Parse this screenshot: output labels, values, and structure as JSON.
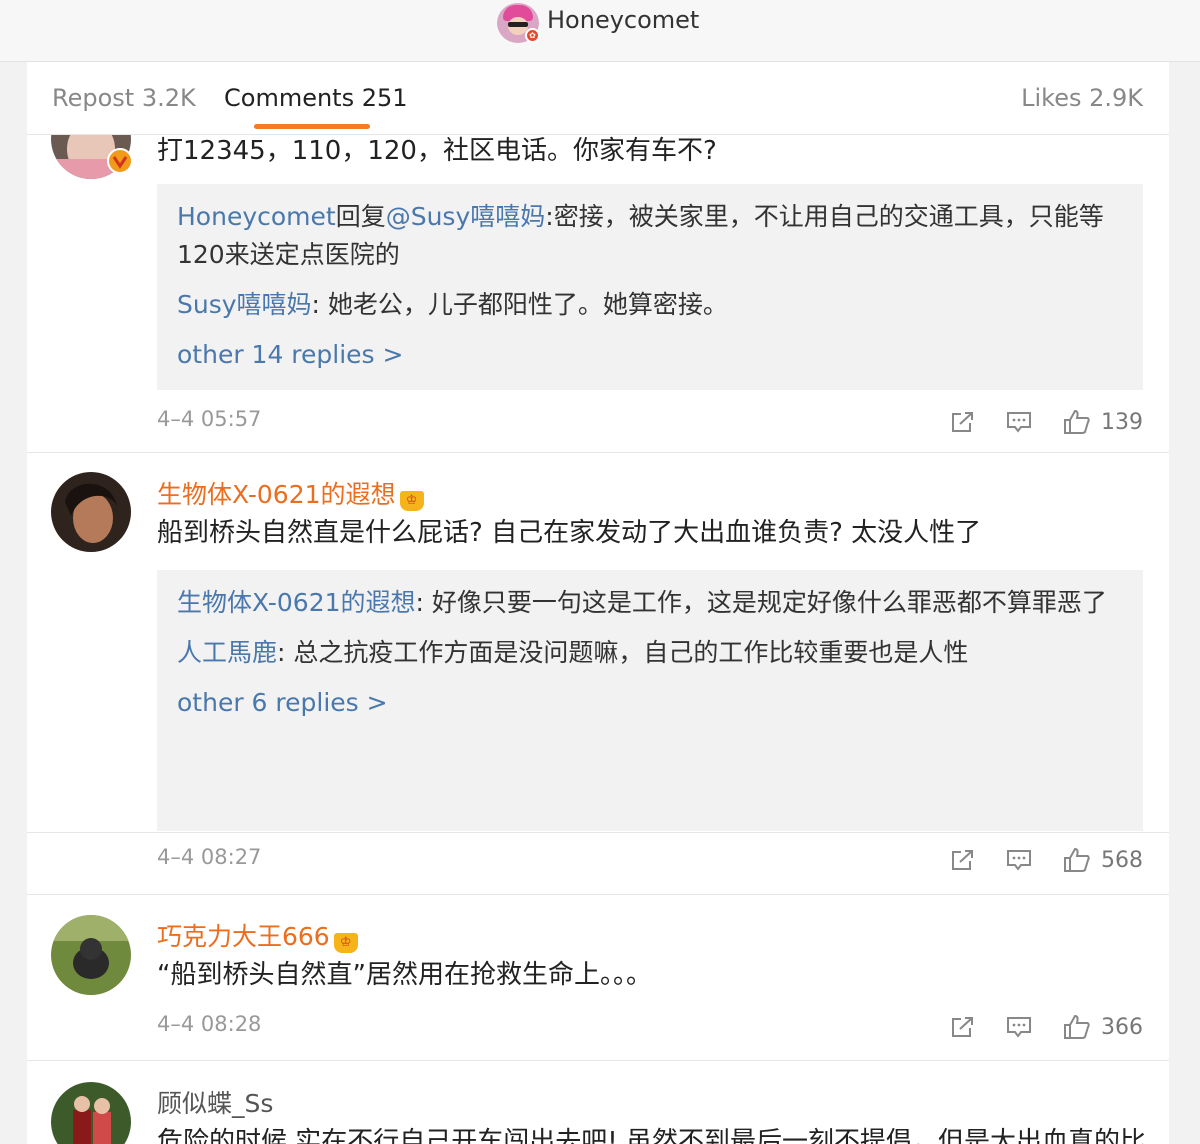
{
  "header": {
    "title": "Honeycomet"
  },
  "tabs": {
    "repost": "Repost 3.2K",
    "comments": "Comments 251",
    "likes": "Likes 2.9K"
  },
  "comments": [
    {
      "text": "打12345，110，120，社区电话。你家有车不?",
      "replies": [
        {
          "name": "Honeycomet",
          "connector": "回复",
          "at": "@Susy嘻嘻妈",
          "text": ":密接，被关家里，不让用自己的交通工具，只能等120来送定点医院的"
        },
        {
          "name": "Susy嘻嘻妈",
          "text": ": 她老公，儿子都阳性了。她算密接。"
        }
      ],
      "more": "other 14 replies >",
      "time": "4–4 05:57",
      "likes": "139"
    },
    {
      "user": "生物体X-0621的遐想",
      "text": "船到桥头自然直是什么屁话? 自己在家发动了大出血谁负责? 太没人性了",
      "replies": [
        {
          "name": "生物体X-0621的遐想",
          "text": ": 好像只要一句这是工作，这是规定好像什么罪恶都不算罪恶了"
        },
        {
          "name": "人工馬鹿",
          "text": ": 总之抗疫工作方面是没问题嘛，自己的工作比较重要也是人性"
        }
      ],
      "more": "other 6 replies >",
      "time": "4–4 08:27",
      "likes": "568"
    },
    {
      "user": "巧克力大王666",
      "text": "“船到桥头自然直”居然用在抢救生命上。。。",
      "time": "4–4 08:28",
      "likes": "366"
    },
    {
      "user": "顾似蝶_Ss",
      "text": "危险的时候 实在不行自己开车闯出去吧! 虽然不到最后一刻不提倡，但是大出血真的比阳性危险的多!"
    }
  ],
  "icons": [
    "share-icon",
    "comment-icon",
    "thumbs-up-icon",
    "verified-badge-icon",
    "crown-icon"
  ],
  "colors": {
    "accent_orange": "#f77b25",
    "username_orange": "#eb6d1e",
    "link_blue": "#4a78ad",
    "reply_bg": "#f2f2f2"
  }
}
